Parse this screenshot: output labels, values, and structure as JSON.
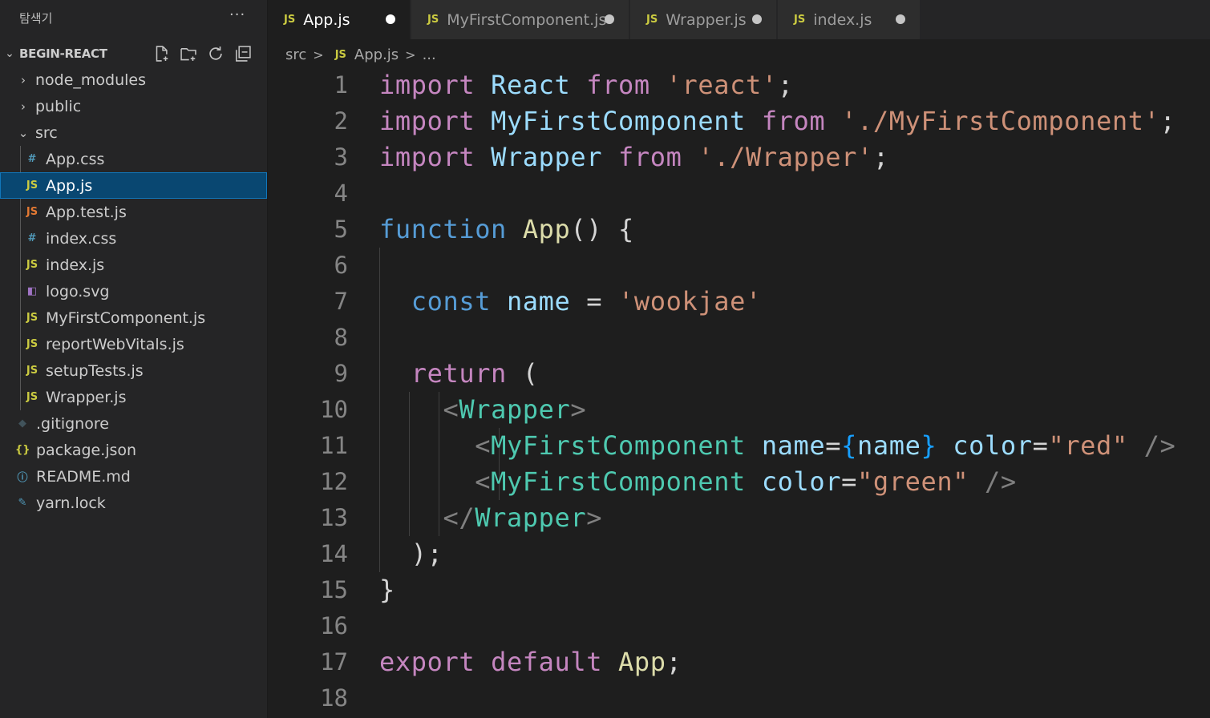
{
  "sidebar": {
    "title": "탐색기",
    "more": "···",
    "section": "BEGIN-REACT",
    "actions": [
      "new-file-icon",
      "new-folder-icon",
      "refresh-icon",
      "collapse-all-icon"
    ],
    "items": [
      {
        "label": "node_modules",
        "twist": "›",
        "icon": "",
        "icon_name": "chevron-right-icon"
      },
      {
        "label": "public",
        "twist": "›",
        "icon": "",
        "icon_name": "chevron-right-icon"
      },
      {
        "label": "src",
        "twist": "⌄",
        "icon": "",
        "icon_name": "chevron-down-icon"
      },
      {
        "label": "App.css",
        "icon": "#",
        "icon_name": "css-file-icon"
      },
      {
        "label": "App.js",
        "icon": "JS",
        "icon_name": "js-file-icon"
      },
      {
        "label": "App.test.js",
        "icon": "JS",
        "icon_name": "test-js-file-icon"
      },
      {
        "label": "index.css",
        "icon": "#",
        "icon_name": "css-file-icon"
      },
      {
        "label": "index.js",
        "icon": "JS",
        "icon_name": "js-file-icon"
      },
      {
        "label": "logo.svg",
        "icon": "◧",
        "icon_name": "svg-file-icon"
      },
      {
        "label": "MyFirstComponent.js",
        "icon": "JS",
        "icon_name": "js-file-icon"
      },
      {
        "label": "reportWebVitals.js",
        "icon": "JS",
        "icon_name": "js-file-icon"
      },
      {
        "label": "setupTests.js",
        "icon": "JS",
        "icon_name": "js-file-icon"
      },
      {
        "label": "Wrapper.js",
        "icon": "JS",
        "icon_name": "js-file-icon"
      },
      {
        "label": ".gitignore",
        "icon": "◆",
        "icon_name": "git-file-icon"
      },
      {
        "label": "package.json",
        "icon": "{}",
        "icon_name": "json-file-icon"
      },
      {
        "label": "README.md",
        "icon": "ⓘ",
        "icon_name": "info-file-icon"
      },
      {
        "label": "yarn.lock",
        "icon": "✎",
        "icon_name": "yarn-file-icon"
      }
    ],
    "selected": "App.js"
  },
  "tabs": [
    {
      "icon": "JS",
      "label": "App.js",
      "active": true,
      "modified": true
    },
    {
      "icon": "JS",
      "label": "MyFirstComponent.js",
      "active": false,
      "modified": true
    },
    {
      "icon": "JS",
      "label": "Wrapper.js",
      "active": false,
      "modified": true
    },
    {
      "icon": "JS",
      "label": "index.js",
      "active": false,
      "modified": true
    }
  ],
  "breadcrumb": {
    "folder": "src",
    "sep": ">",
    "file_icon": "JS",
    "file": "App.js",
    "more": "..."
  },
  "editor": {
    "line_numbers": [
      "1",
      "2",
      "3",
      "4",
      "5",
      "6",
      "7",
      "8",
      "9",
      "10",
      "11",
      "12",
      "13",
      "14",
      "15",
      "16",
      "17",
      "18"
    ],
    "lines": [
      [
        [
          "kw",
          "import"
        ],
        [
          "pl",
          " "
        ],
        [
          "vr",
          "React"
        ],
        [
          "pl",
          " "
        ],
        [
          "kw",
          "from"
        ],
        [
          "pl",
          " "
        ],
        [
          "st",
          "'react'"
        ],
        [
          "pl",
          ";"
        ]
      ],
      [
        [
          "kw",
          "import"
        ],
        [
          "pl",
          " "
        ],
        [
          "vr",
          "MyFirstComponent"
        ],
        [
          "pl",
          " "
        ],
        [
          "kw",
          "from"
        ],
        [
          "pl",
          " "
        ],
        [
          "st",
          "'./MyFirstComponent'"
        ],
        [
          "pl",
          ";"
        ]
      ],
      [
        [
          "kw",
          "import"
        ],
        [
          "pl",
          " "
        ],
        [
          "vr",
          "Wrapper"
        ],
        [
          "pl",
          " "
        ],
        [
          "kw",
          "from"
        ],
        [
          "pl",
          " "
        ],
        [
          "st",
          "'./Wrapper'"
        ],
        [
          "pl",
          ";"
        ]
      ],
      [],
      [
        [
          "bl",
          "function"
        ],
        [
          "pl",
          " "
        ],
        [
          "fn",
          "App"
        ],
        [
          "pl",
          "() {"
        ]
      ],
      [],
      [
        [
          "pl",
          "  "
        ],
        [
          "bl",
          "const"
        ],
        [
          "pl",
          " "
        ],
        [
          "vr",
          "name"
        ],
        [
          "pl",
          " = "
        ],
        [
          "st",
          "'wookjae'"
        ]
      ],
      [],
      [
        [
          "pl",
          "  "
        ],
        [
          "kw",
          "return"
        ],
        [
          "pl",
          " ("
        ]
      ],
      [
        [
          "pl",
          "    "
        ],
        [
          "gy",
          "<"
        ],
        [
          "tg",
          "Wrapper"
        ],
        [
          "gy",
          ">"
        ]
      ],
      [
        [
          "pl",
          "      "
        ],
        [
          "gy",
          "<"
        ],
        [
          "tg",
          "MyFirstComponent"
        ],
        [
          "pl",
          " "
        ],
        [
          "at",
          "name"
        ],
        [
          "pl",
          "="
        ],
        [
          "br2",
          "{"
        ],
        [
          "vr",
          "name"
        ],
        [
          "br2",
          "}"
        ],
        [
          "pl",
          " "
        ],
        [
          "at",
          "color"
        ],
        [
          "pl",
          "="
        ],
        [
          "st",
          "\"red\""
        ],
        [
          "pl",
          " "
        ],
        [
          "gy",
          "/>"
        ]
      ],
      [
        [
          "pl",
          "      "
        ],
        [
          "gy",
          "<"
        ],
        [
          "tg",
          "MyFirstComponent"
        ],
        [
          "pl",
          " "
        ],
        [
          "at",
          "color"
        ],
        [
          "pl",
          "="
        ],
        [
          "st",
          "\"green\""
        ],
        [
          "pl",
          " "
        ],
        [
          "gy",
          "/>"
        ]
      ],
      [
        [
          "pl",
          "    "
        ],
        [
          "gy",
          "</"
        ],
        [
          "tg",
          "Wrapper"
        ],
        [
          "gy",
          ">"
        ]
      ],
      [
        [
          "pl",
          "  );"
        ]
      ],
      [
        [
          "pl",
          "}"
        ]
      ],
      [],
      [
        [
          "kw",
          "export"
        ],
        [
          "pl",
          " "
        ],
        [
          "kw",
          "default"
        ],
        [
          "pl",
          " "
        ],
        [
          "fn",
          "App"
        ],
        [
          "pl",
          ";"
        ]
      ],
      []
    ]
  }
}
